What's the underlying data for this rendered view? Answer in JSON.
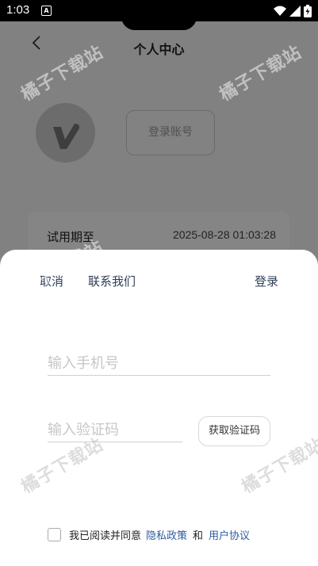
{
  "status_bar": {
    "time": "1:03",
    "notification_icon": "A",
    "icons": [
      "wifi-icon",
      "signal-icon",
      "battery-icon"
    ]
  },
  "background_page": {
    "title": "个人中心",
    "login_account_label": "登录账号",
    "trial": {
      "label": "试用期至",
      "value": "2025-08-28 01:03:28"
    }
  },
  "watermark_text": "橘子下载站",
  "sheet": {
    "cancel_label": "取消",
    "contact_label": "联系我们",
    "login_label": "登录",
    "phone_placeholder": "输入手机号",
    "code_placeholder": "输入验证码",
    "get_code_label": "获取验证码",
    "agreement": {
      "prefix": "我已阅读并同意",
      "privacy_label": "隐私政策",
      "and_label": "和",
      "terms_label": "用户协议",
      "checked": false
    }
  },
  "colors": {
    "link": "#2f5b9e",
    "sheet_text": "#2f3e58",
    "overlay": "rgba(0,0,0,0.48)"
  }
}
